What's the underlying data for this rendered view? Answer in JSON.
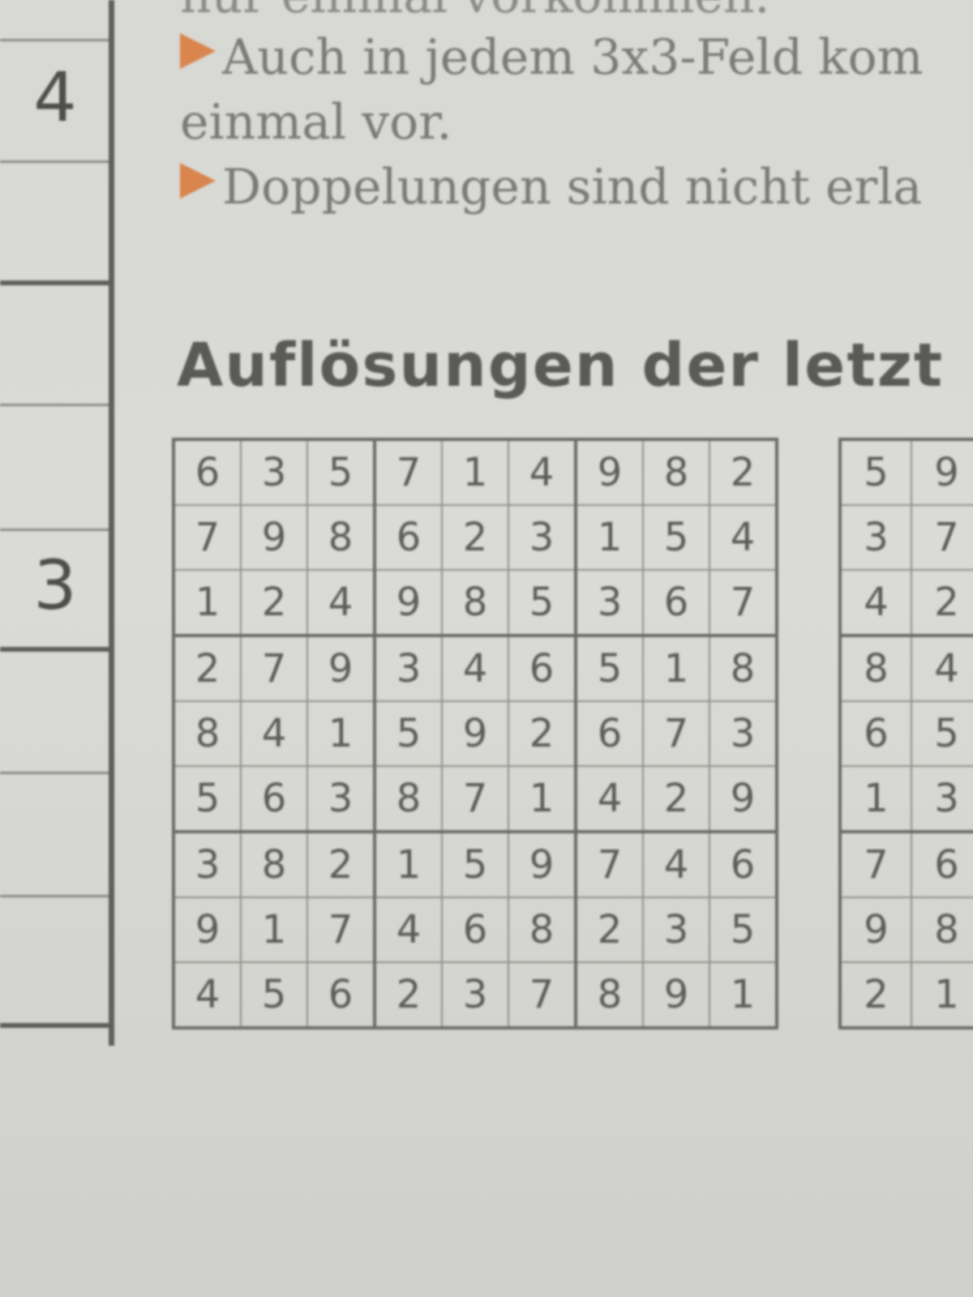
{
  "sidebar": {
    "numbers": [
      "4",
      "3"
    ]
  },
  "rules": {
    "line_top_fragment": "nur einmal vorkommen.",
    "line1": "Auch in jedem 3x3-Feld kom",
    "line1_cont": "einmal vor.",
    "line2": "Doppelungen sind nicht erla",
    "arrow_color": "#d9854d"
  },
  "heading": "Auflösungen der letzt",
  "sudoku_main": [
    [
      "6",
      "3",
      "5",
      "7",
      "1",
      "4",
      "9",
      "8",
      "2"
    ],
    [
      "7",
      "9",
      "8",
      "6",
      "2",
      "3",
      "1",
      "5",
      "4"
    ],
    [
      "1",
      "2",
      "4",
      "9",
      "8",
      "5",
      "3",
      "6",
      "7"
    ],
    [
      "2",
      "7",
      "9",
      "3",
      "4",
      "6",
      "5",
      "1",
      "8"
    ],
    [
      "8",
      "4",
      "1",
      "5",
      "9",
      "2",
      "6",
      "7",
      "3"
    ],
    [
      "5",
      "6",
      "3",
      "8",
      "7",
      "1",
      "4",
      "2",
      "9"
    ],
    [
      "3",
      "8",
      "2",
      "1",
      "5",
      "9",
      "7",
      "4",
      "6"
    ],
    [
      "9",
      "1",
      "7",
      "4",
      "6",
      "8",
      "2",
      "3",
      "5"
    ],
    [
      "4",
      "5",
      "6",
      "2",
      "3",
      "7",
      "8",
      "9",
      "1"
    ]
  ],
  "sudoku_right_partial": [
    [
      "5",
      "9"
    ],
    [
      "3",
      "7"
    ],
    [
      "4",
      "2"
    ],
    [
      "8",
      "4"
    ],
    [
      "6",
      "5"
    ],
    [
      "1",
      "3"
    ],
    [
      "7",
      "6"
    ],
    [
      "9",
      "8"
    ],
    [
      "2",
      "1"
    ]
  ]
}
